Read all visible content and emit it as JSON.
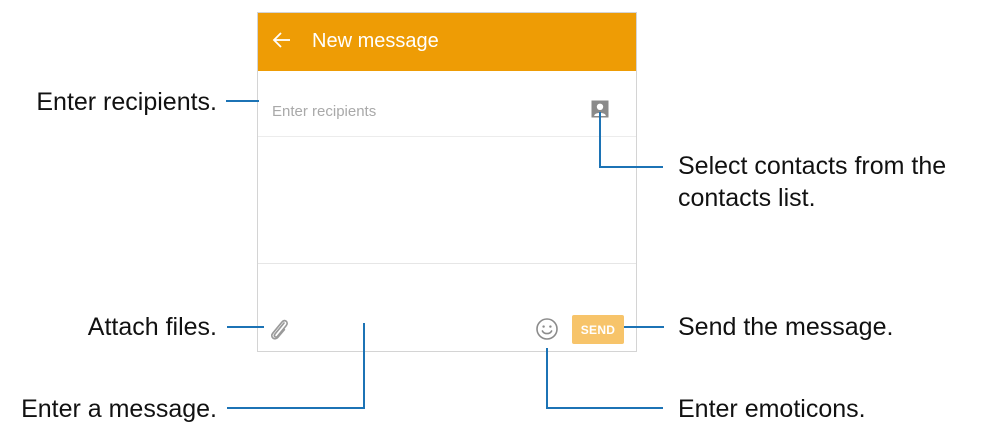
{
  "app": {
    "title": "New message",
    "back_icon": "arrow-left-icon"
  },
  "recipients": {
    "placeholder": "Enter recipients",
    "contacts_icon": "contact-card-icon"
  },
  "compose": {
    "attach_icon": "paperclip-icon",
    "emoticon_icon": "smiley-icon",
    "send_label": "SEND"
  },
  "callouts": {
    "enter_recipients": "Enter recipients.",
    "select_contacts_line1": "Select contacts from the",
    "select_contacts_line2": "contacts list.",
    "attach_files": "Attach files.",
    "send_message": "Send the message.",
    "enter_message": "Enter a message.",
    "enter_emoticons": "Enter emoticons."
  },
  "colors": {
    "app_bar": "#ee9c05",
    "send_button": "#f7c46a",
    "leader_lines": "#1c73b5"
  }
}
